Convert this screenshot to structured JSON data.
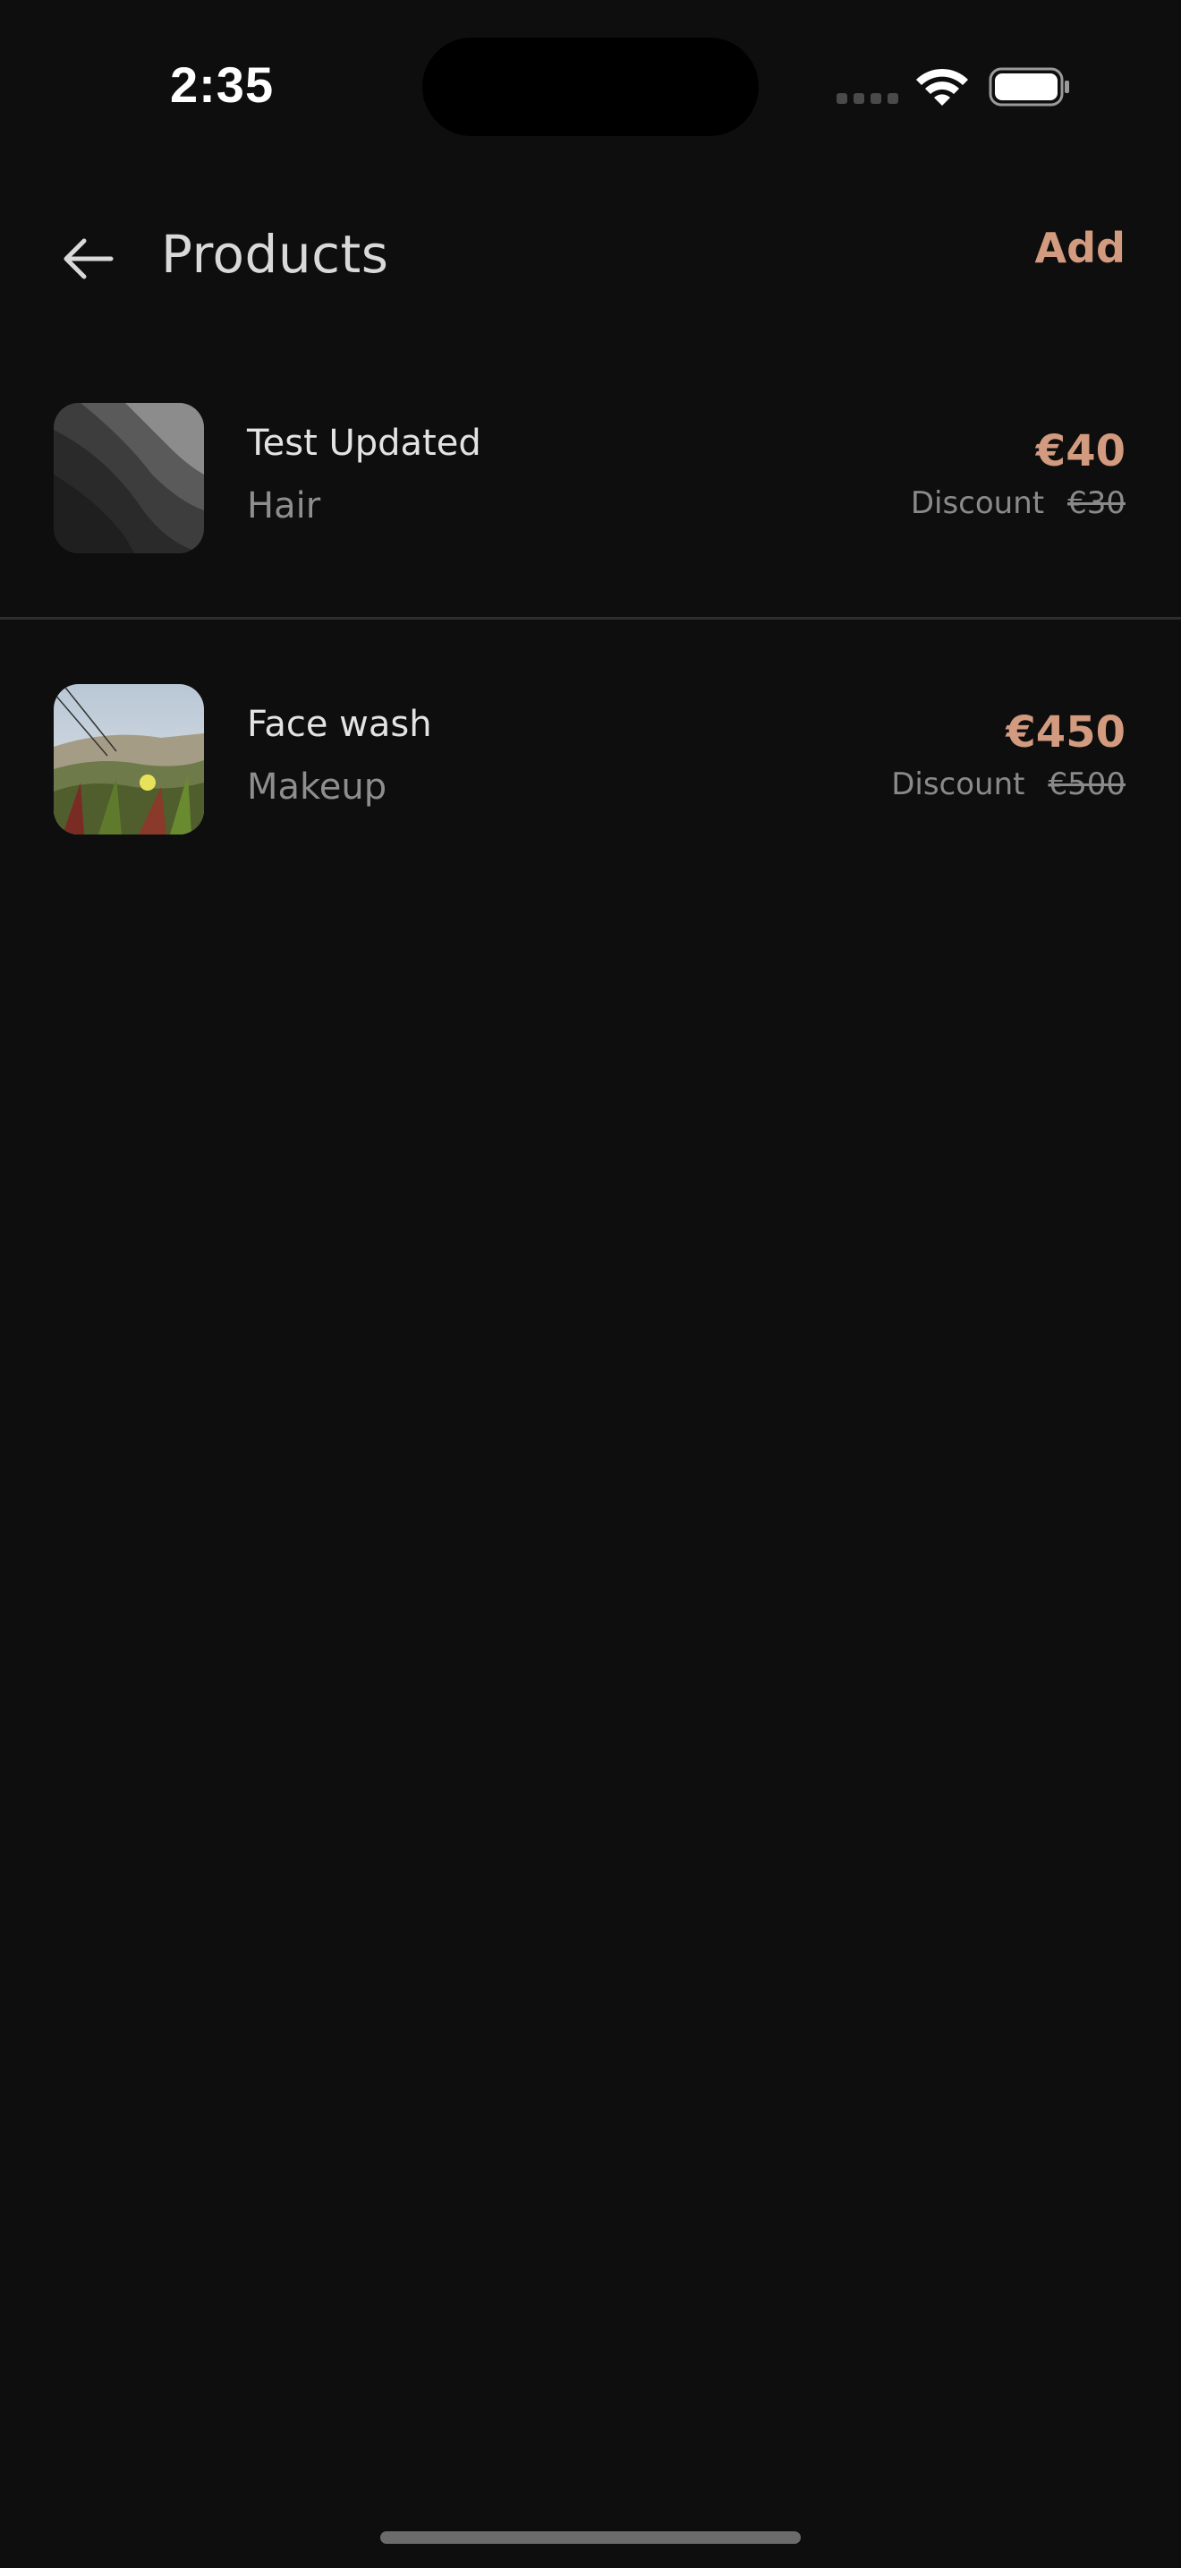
{
  "status_bar": {
    "time": "2:35"
  },
  "header": {
    "title": "Products",
    "add_label": "Add"
  },
  "products": [
    {
      "name": "Test Updated",
      "category": "Hair",
      "price": "€40",
      "discount_label": "Discount",
      "original_price": "€30",
      "thumbnail": "abstract-gray-waves-image"
    },
    {
      "name": "Face wash",
      "category": "Makeup",
      "price": "€450",
      "discount_label": "Discount",
      "original_price": "€500",
      "thumbnail": "dune-flower-photo"
    }
  ],
  "colors": {
    "background": "#0e0e0e",
    "accent": "#d29a7e",
    "primary_text": "#e3e3e3",
    "secondary_text": "#8e8e8e",
    "divider": "#2e2e2e"
  }
}
